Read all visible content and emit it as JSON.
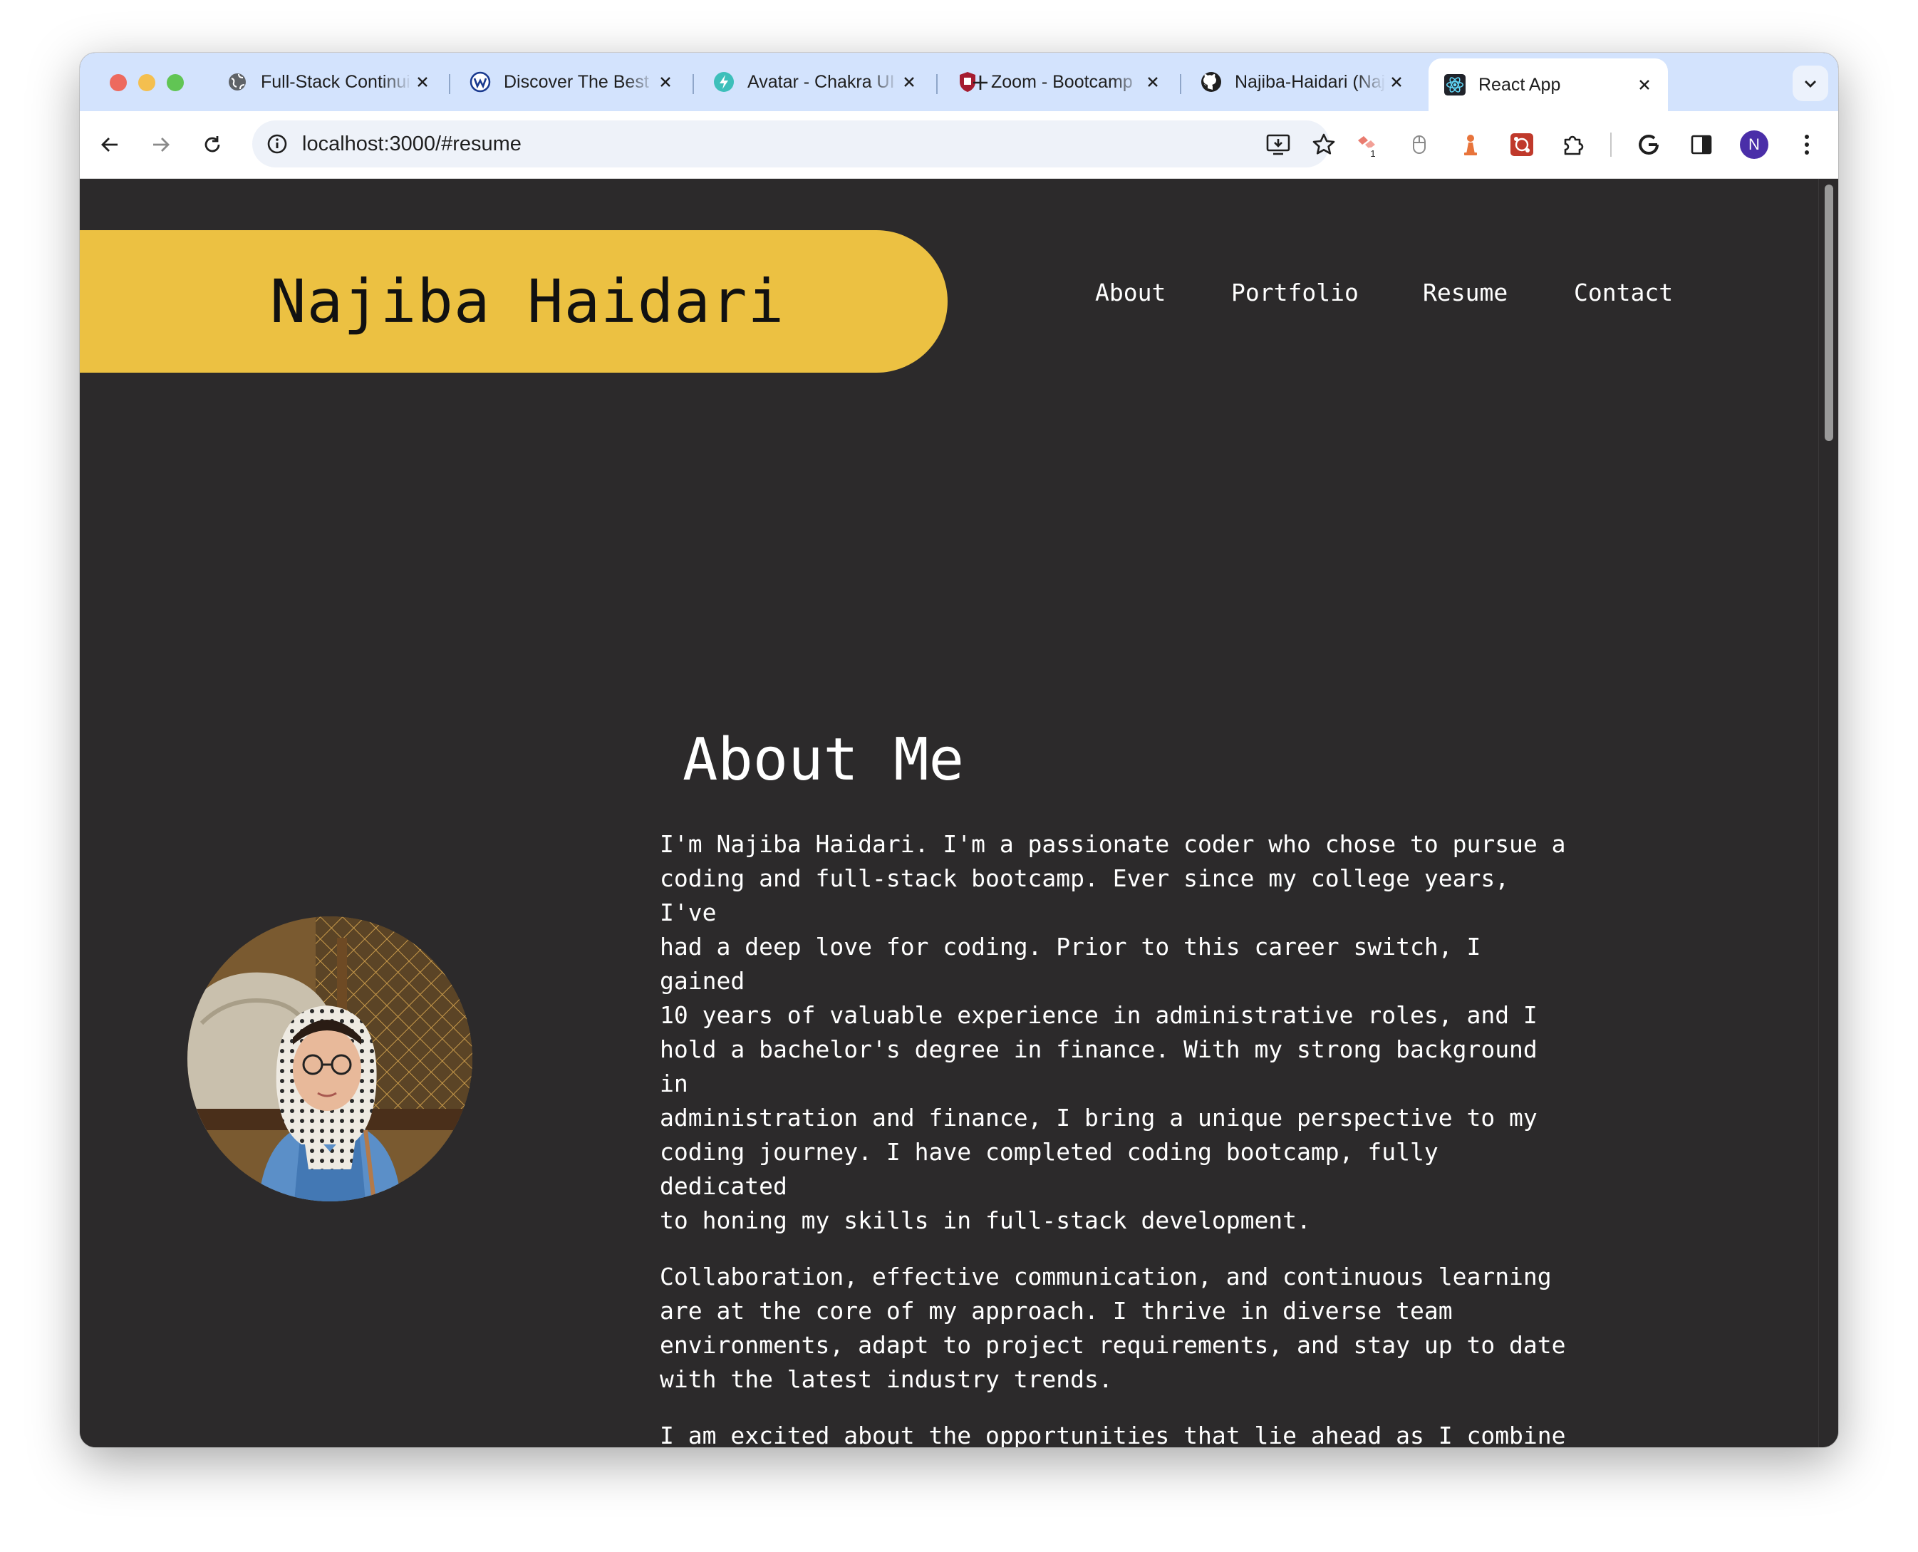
{
  "browser": {
    "tabs": [
      {
        "title": "Full-Stack Continuing Education",
        "favicon": "globe-icon"
      },
      {
        "title": "Discover The Best",
        "favicon": "webflow-icon"
      },
      {
        "title": "Avatar - Chakra UI",
        "favicon": "chakra-icon"
      },
      {
        "title": "Zoom - Bootcamp",
        "favicon": "shield-icon"
      },
      {
        "title": "Najiba-Haidari (Najiba)",
        "favicon": "github-icon"
      },
      {
        "title": "React App",
        "favicon": "react-icon",
        "active": true
      }
    ],
    "url": "localhost:3000/#resume",
    "extension_badge": "1",
    "profile_initial": "N"
  },
  "site": {
    "name": "Najiba Haidari",
    "nav": [
      "About",
      "Portfolio",
      "Resume",
      "Contact"
    ]
  },
  "about": {
    "title": "About Me",
    "paragraphs": [
      "I'm Najiba Haidari. I'm a passionate coder who chose to pursue a\ncoding and full-stack bootcamp. Ever since my college years, I've\nhad a deep love for coding. Prior to this career switch, I gained\n10 years of valuable experience in administrative roles, and I\nhold a bachelor's degree in finance. With my strong background in\nadministration and finance, I bring a unique perspective to my\ncoding journey. I have completed coding bootcamp, fully dedicated\nto honing my skills in full-stack development.",
      "Collaboration, effective communication, and continuous learning\nare at the core of my approach. I thrive in diverse team\nenvironments, adapt to project requirements, and stay up to date\nwith the latest industry trends.",
      "I am excited about the opportunities that lie ahead as I combine\nmy administrative expertise with my passion for coding. Let's\nconnect and create something amazing together!"
    ]
  },
  "colors": {
    "page_bg": "#2c2a2b",
    "banner": "#ecc142",
    "tabstrip": "#d3e3fd"
  }
}
